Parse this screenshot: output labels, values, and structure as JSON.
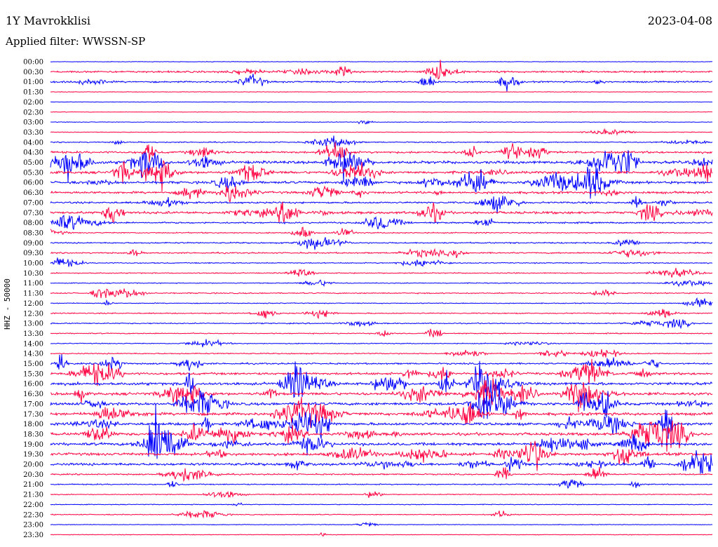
{
  "header": {
    "station": "1Y Mavrokklisi",
    "date": "2023-04-08",
    "filter": "Applied filter: WWSSN-SP"
  },
  "chart_data": {
    "type": "line",
    "title": "1Y Mavrokklisi",
    "ylabel": "HHZ - 50000",
    "colors": [
      "#0000ff",
      "#ff0040"
    ],
    "rows": [
      "00:00",
      "00:30",
      "01:00",
      "01:30",
      "02:00",
      "02:30",
      "03:00",
      "03:30",
      "04:00",
      "04:30",
      "05:00",
      "05:30",
      "06:00",
      "06:30",
      "07:00",
      "07:30",
      "08:00",
      "08:30",
      "09:00",
      "09:30",
      "10:00",
      "10:30",
      "11:00",
      "11:30",
      "12:00",
      "12:30",
      "13:00",
      "13:30",
      "14:00",
      "14:30",
      "15:00",
      "15:30",
      "16:00",
      "16:30",
      "17:00",
      "17:30",
      "18:00",
      "18:30",
      "19:00",
      "19:30",
      "20:00",
      "20:30",
      "21:00",
      "21:30",
      "22:00",
      "22:30",
      "23:00",
      "23:30"
    ],
    "activity": [
      0.05,
      0.6,
      0.5,
      0.05,
      0.05,
      0.05,
      0.08,
      0.1,
      0.3,
      0.7,
      1.0,
      0.9,
      0.9,
      0.8,
      0.6,
      0.9,
      0.5,
      0.3,
      0.4,
      0.4,
      0.25,
      0.25,
      0.2,
      0.3,
      0.2,
      0.3,
      0.3,
      0.25,
      0.2,
      0.3,
      0.5,
      0.8,
      1.0,
      1.0,
      1.0,
      1.0,
      1.0,
      1.0,
      1.0,
      1.0,
      0.9,
      0.4,
      0.3,
      0.2,
      0.15,
      0.2,
      0.1,
      0.1
    ]
  }
}
